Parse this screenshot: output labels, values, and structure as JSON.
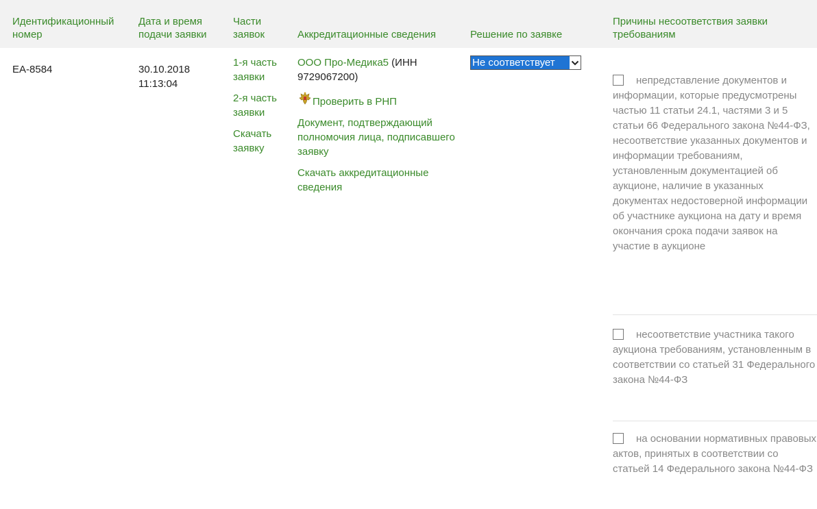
{
  "columns": {
    "id": "Идентификационный номер",
    "datetime": "Дата и время подачи заявки",
    "parts": "Части заявок",
    "accreditation": "Аккредитационные сведения",
    "decision": "Решение по заявке",
    "reasons": "Причины несоответствия заявки требованиям"
  },
  "row": {
    "id": "ЕА-8584",
    "date": "30.10.2018",
    "time": "11:13:04",
    "parts": [
      "1-я часть заявки",
      "2-я часть заявки",
      "Скачать заявку"
    ],
    "company_link": "ООО Про-Медика5",
    "company_inn": " (ИНН 9729067200)",
    "rnp_link": "Проверить в РНП",
    "doc_link": "Документ, подтверждающий полномочия лица, подписавшего заявку",
    "download_accreditation": "Скачать аккредитационные сведения",
    "decision_value": "Не соответствует",
    "reasons": [
      "непредставление документов и информации, которые предусмотрены частью 11 статьи 24.1, частями 3 и 5 статьи 66 Федерального закона №44-ФЗ, несоответствие указанных документов и информации требованиям, установленным документацией об аукционе, наличие в указанных документах недостоверной информации об участнике аукциона на дату и время окончания срока подачи заявок на участие в аукционе",
      "несоответствие участника такого аукциона требованиям, установленным в соответствии со статьей 31 Федерального закона №44-ФЗ",
      "на основании нормативных правовых актов, принятых в соответствии со статьей 14 Федерального закона №44-ФЗ"
    ]
  },
  "icons": {
    "emblem": "russian-emblem-icon",
    "dropdown": "chevron-down-icon"
  },
  "colors": {
    "accent": "#3a8a2a",
    "header_bg": "#f2f2f2",
    "select_highlight": "#1f74d4"
  }
}
